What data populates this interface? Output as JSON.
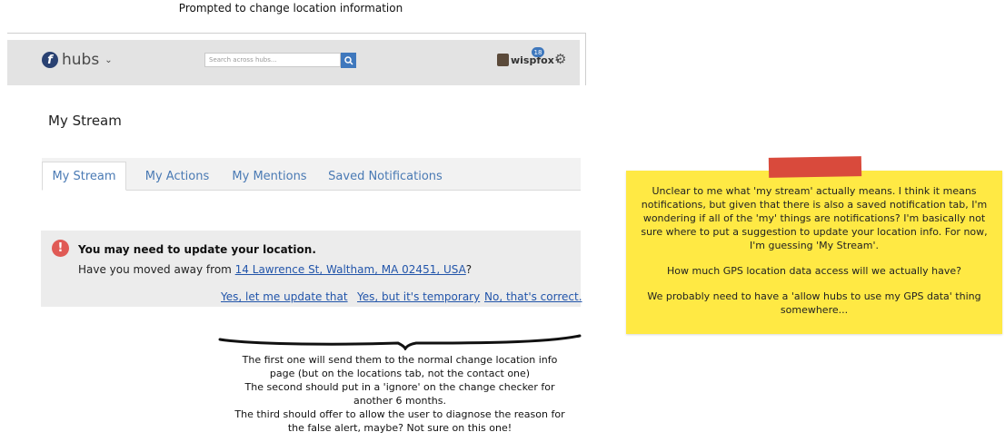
{
  "caption_top": "Prompted to change location information",
  "header": {
    "brand": "hubs",
    "search_placeholder": "Search across hubs...",
    "username": "wispfox",
    "badge_count": "18"
  },
  "page": {
    "title": "My Stream",
    "tabs": [
      "My Stream",
      "My Actions",
      "My Mentions",
      "Saved Notifications"
    ],
    "active_tab": "My Stream"
  },
  "alert": {
    "title": "You may need to update your location.",
    "text_prefix": "Have you moved away from ",
    "address": "14 Lawrence St, Waltham, MA 02451, USA",
    "text_suffix": "?",
    "actions": [
      "Yes, let me update that",
      "Yes, but it's temporary",
      "No, that's correct."
    ]
  },
  "annotation_bottom": [
    "The first one will send them to the normal change location info",
    "page (but on the locations tab, not the contact one)",
    "The second should put in a 'ignore' on the change checker for",
    "another 6 months.",
    "The third should offer to allow the user to diagnose the reason for",
    "the false alert, maybe? Not sure on this one!"
  ],
  "sticky_note": {
    "paragraph1": "Unclear to me what 'my stream' actually means. I think it means notifications, but given that there is also a saved notification tab, I'm wondering if all of the 'my' things are notifications? I'm basically not sure where to put a suggestion to update your location info. For now, I'm guessing 'My Stream'.",
    "paragraph2": "How much GPS location data access will we actually have?",
    "paragraph3": "We probably need to have a 'allow hubs to use my GPS data' thing somewhere..."
  },
  "colors": {
    "link": "#2255aa",
    "tab": "#4a7ab4",
    "alert_icon": "#e05a55",
    "sticky": "#ffe944",
    "tape": "#d94a3c",
    "search_button": "#3f78bd"
  }
}
